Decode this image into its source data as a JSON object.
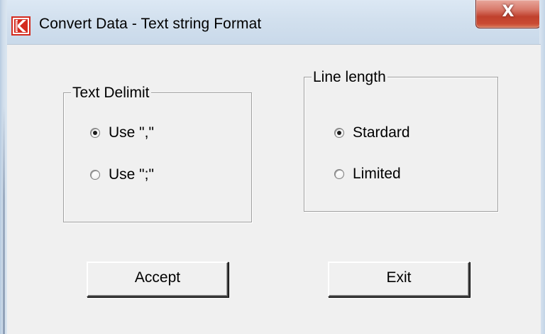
{
  "window": {
    "title": "Convert Data - Text string Format",
    "close_label": "X",
    "app_icon": "app-logo-icon"
  },
  "groups": {
    "text_delimit": {
      "legend": "Text Delimit",
      "options": [
        {
          "label": "Use \",\"",
          "checked": true
        },
        {
          "label": "Use \";\"",
          "checked": false
        }
      ]
    },
    "line_length": {
      "legend": "Line length",
      "options": [
        {
          "label": "Stardard",
          "checked": true
        },
        {
          "label": "Limited",
          "checked": false
        }
      ]
    }
  },
  "buttons": {
    "accept_label": "Accept",
    "exit_label": "Exit"
  },
  "colors": {
    "close_button": "#c94a33",
    "client_bg": "#f0f0f0",
    "titlebar_bg": "#d2e0ee",
    "logo_red": "#d42a1e"
  }
}
